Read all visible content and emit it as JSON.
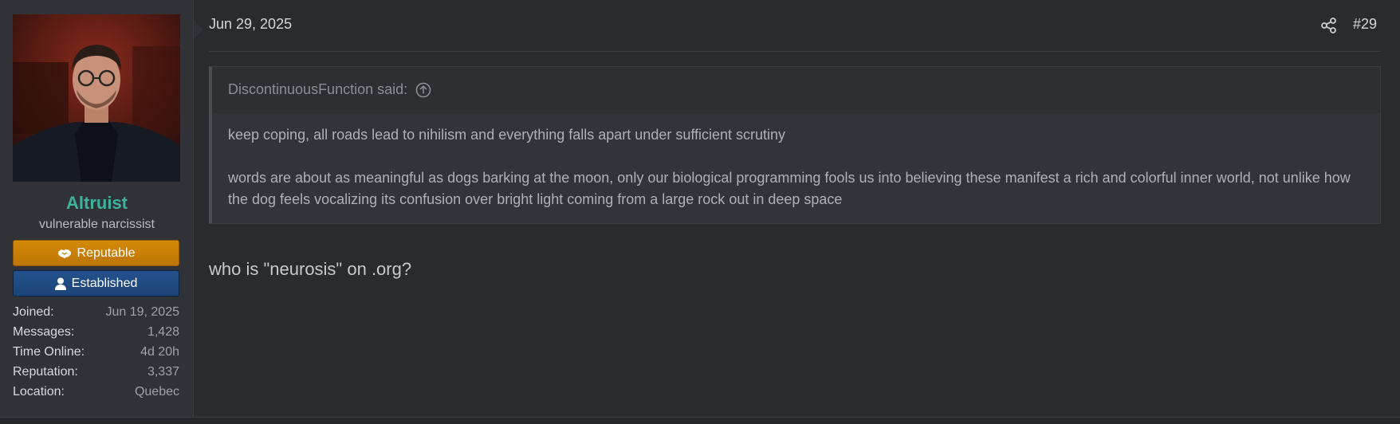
{
  "user": {
    "name": "Altruist",
    "title": "vulnerable narcissist",
    "banners": {
      "reputable": "Reputable",
      "established": "Established"
    },
    "stats": [
      {
        "label": "Joined:",
        "value": "Jun 19, 2025"
      },
      {
        "label": "Messages:",
        "value": "1,428"
      },
      {
        "label": "Time Online:",
        "value": "4d 20h"
      },
      {
        "label": "Reputation:",
        "value": "3,337"
      },
      {
        "label": "Location:",
        "value": "Quebec"
      }
    ]
  },
  "post": {
    "date": "Jun 29, 2025",
    "number": "#29",
    "quote": {
      "author_line": "DiscontinuousFunction said:",
      "paragraphs": [
        "keep coping, all roads lead to nihilism and everything falls apart under sufficient scrutiny",
        "words are about as meaningful as dogs barking at the moon, only our biological programming fools us into believing these manifest a rich and colorful inner world, not unlike how the dog feels vocalizing its confusion over bright light coming from a large rock out in deep space"
      ]
    },
    "reply": "who is \"neurosis\" on .org?"
  },
  "colors": {
    "username": "#3fb39a",
    "reputable_banner": "#d48a06",
    "established_banner": "#23528d",
    "background": "#2a2b2f"
  },
  "icons": {
    "share": "share-icon",
    "quote_jump": "arrow-up-circle-icon",
    "reputable": "handshake-icon",
    "established": "user-icon"
  }
}
